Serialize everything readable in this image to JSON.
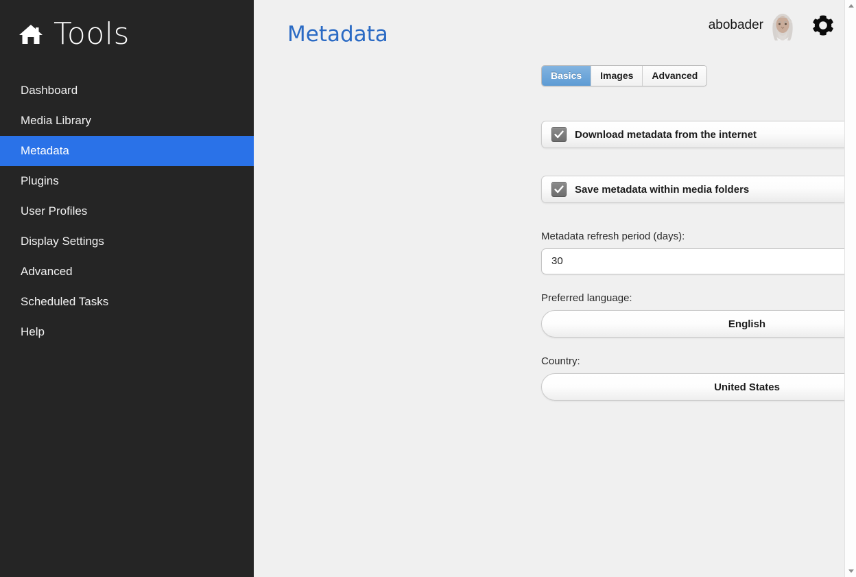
{
  "sidebar": {
    "brand": {
      "icon": "home-icon",
      "title": "Tools"
    },
    "items": [
      {
        "label": "Dashboard",
        "active": false
      },
      {
        "label": "Media Library",
        "active": false
      },
      {
        "label": "Metadata",
        "active": true
      },
      {
        "label": "Plugins",
        "active": false
      },
      {
        "label": "User Profiles",
        "active": false
      },
      {
        "label": "Display Settings",
        "active": false
      },
      {
        "label": "Advanced",
        "active": false
      },
      {
        "label": "Scheduled Tasks",
        "active": false
      },
      {
        "label": "Help",
        "active": false
      }
    ],
    "colors": {
      "background": "#252525",
      "active_item": "#2a72e8",
      "text": "#f2f2f2"
    }
  },
  "header": {
    "page_title": "Metadata",
    "page_title_color": "#2a6ac4",
    "user_name": "abobader",
    "avatar_icon": "user-avatar",
    "settings_icon": "gear-icon"
  },
  "tabs": [
    {
      "label": "Basics",
      "active": true
    },
    {
      "label": "Images",
      "active": false
    },
    {
      "label": "Advanced",
      "active": false
    }
  ],
  "form": {
    "checkboxes": [
      {
        "label": "Download metadata from the internet",
        "checked": true
      },
      {
        "label": "Save metadata within media folders",
        "checked": true
      }
    ],
    "refresh_period": {
      "label": "Metadata refresh period (days):",
      "value": "30",
      "placeholder": "30"
    },
    "language": {
      "label": "Preferred language:",
      "value": "English",
      "chevron_icon": "chevron-down-icon"
    },
    "country": {
      "label": "Country:",
      "value": "United States",
      "chevron_icon": "chevron-down-icon"
    }
  },
  "scrollbar": {
    "up_icon": "scroll-up-arrow",
    "down_icon": "scroll-down-arrow"
  }
}
